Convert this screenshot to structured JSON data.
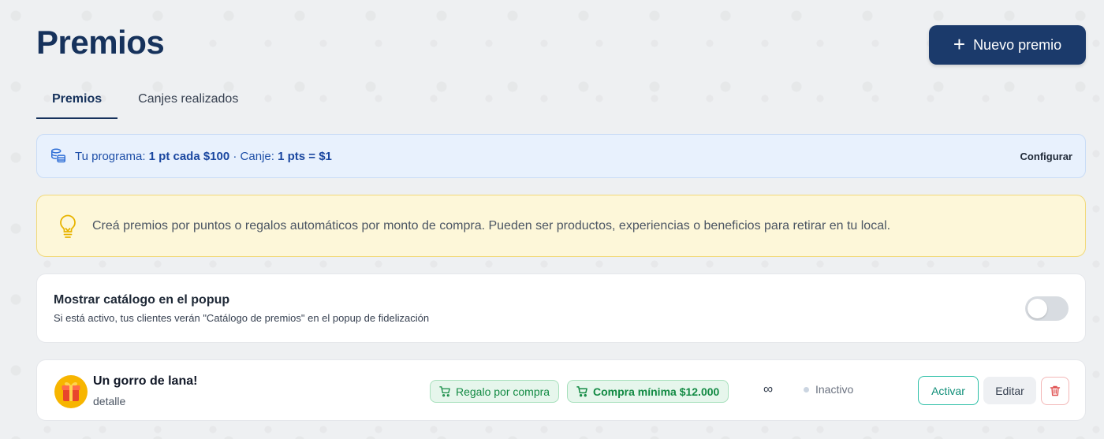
{
  "page": {
    "title": "Premios"
  },
  "header": {
    "new_button_label": "Nuevo premio"
  },
  "tabs": [
    {
      "label": "Premios",
      "active": true
    },
    {
      "label": "Canjes realizados",
      "active": false
    }
  ],
  "program": {
    "prefix": "Tu programa:",
    "earn": "1 pt cada $100",
    "separator": "· Canje:",
    "redeem": "1 pts = $1",
    "configure_label": "Configurar"
  },
  "info": {
    "text": "Creá premios por puntos o regalos automáticos por monto de compra. Pueden ser productos, experiencias o beneficios para retirar en tu local."
  },
  "catalog": {
    "title": "Mostrar catálogo en el popup",
    "description": "Si está activo, tus clientes verán \"Catálogo de premios\" en el popup de fidelización",
    "enabled": false
  },
  "rewards": [
    {
      "name": "Un gorro de lana!",
      "detail": "detalle",
      "type_badge": "Regalo por compra",
      "condition_badge": "Compra mínima $12.000",
      "stock": "∞",
      "status": "Inactivo",
      "activate_label": "Activar",
      "edit_label": "Editar"
    }
  ],
  "colors": {
    "primary": "#1b3a6b",
    "title": "#16325c",
    "badge_green": "#128a43",
    "accent_teal": "#2bbfa6",
    "danger": "#e05252"
  }
}
